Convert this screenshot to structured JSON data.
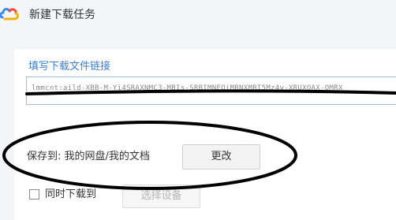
{
  "window": {
    "title": "新建下载任务",
    "logo_icon": "baidu-netdisk-cloud-icon",
    "logo_colors": [
      "#3b8cf0",
      "#e94a3c",
      "#f5b400"
    ]
  },
  "link_section": {
    "label": "填写下载文件链接",
    "input_value": "lmmcnt:aild-XBB-M-Yi4SRAXNMC3-MBIs-SRBIMNEQiMRNXMRI5Mz4y-XRUXOAX-OMRX",
    "input_border_color": "#9dbde8"
  },
  "save_location": {
    "label": "保存到: 我的网盘/我的文档",
    "change_button": "更改"
  },
  "sync_download": {
    "checkbox_label": "同时下载到",
    "checked": false,
    "select_device_button": "选择设备"
  },
  "colors": {
    "accent": "#3a7fd5",
    "background": "#f4f5f7",
    "panel": "#ffffff",
    "annotation": "#000000"
  }
}
